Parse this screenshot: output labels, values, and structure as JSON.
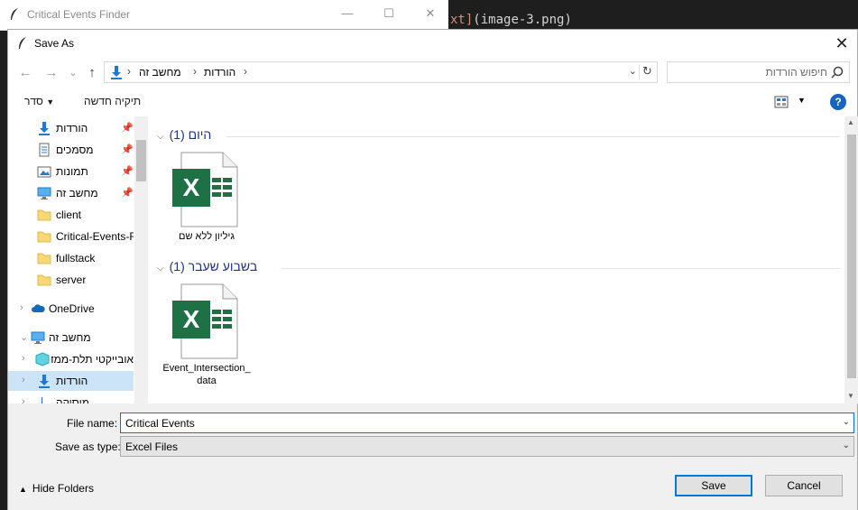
{
  "background_app": {
    "title": "Critical Events Finder",
    "editor_code_prefix": "xt]",
    "editor_code_rest": "(image-3.png)"
  },
  "dialog": {
    "title": "Save As",
    "close_glyph": "✕"
  },
  "navigation": {
    "back": "←",
    "forward": "→",
    "recent": "⌄",
    "up": "↑",
    "breadcrumbs": [
      "מחשב זה",
      "הורדות"
    ],
    "search_placeholder": "חיפוש הורדות"
  },
  "toolbar": {
    "organize": "סדר",
    "new_folder": "תיקיה חדשה",
    "help": "?"
  },
  "nav_pane": {
    "quick_access": [
      {
        "label": "הורדות",
        "icon": "download-icon",
        "pinned": true
      },
      {
        "label": "מסמכים",
        "icon": "documents-icon",
        "pinned": true
      },
      {
        "label": "תמונות",
        "icon": "pictures-icon",
        "pinned": true
      },
      {
        "label": "מחשב זה",
        "icon": "computer-icon",
        "pinned": true
      },
      {
        "label": "client",
        "icon": "folder-icon",
        "pinned": false
      },
      {
        "label": "Critical-Events-F",
        "icon": "folder-icon",
        "pinned": false
      },
      {
        "label": "fullstack",
        "icon": "folder-icon",
        "pinned": false
      },
      {
        "label": "server",
        "icon": "folder-icon",
        "pinned": false
      }
    ],
    "onedrive": "OneDrive",
    "this_pc": "מחשב זה",
    "this_pc_children": [
      {
        "label": "אובייקטי תלת-ממד",
        "icon": "3d-objects-icon"
      },
      {
        "label": "הורדות",
        "icon": "download-icon",
        "selected": true
      },
      {
        "label": "מוסיקה",
        "icon": "music-icon"
      }
    ]
  },
  "content": {
    "groups": [
      {
        "header": "היום (1)",
        "files": [
          {
            "name": "גיליון ללא שם",
            "icon": "excel-file-icon"
          }
        ]
      },
      {
        "header": "בשבוע שעבר (1)",
        "files": [
          {
            "name": "Event_Intersection_data",
            "icon": "excel-file-icon"
          }
        ]
      }
    ]
  },
  "form": {
    "file_name_label": "File name:",
    "file_name_value": "Critical Events",
    "save_type_label": "Save as type:",
    "save_type_value": "Excel Files",
    "hide_folders": "Hide Folders",
    "save_button": "Save",
    "cancel_button": "Cancel"
  },
  "colors": {
    "accent": "#0078d7",
    "excel_green": "#1e7145",
    "group_header": "#1e3287",
    "selection": "#cce4f7"
  }
}
